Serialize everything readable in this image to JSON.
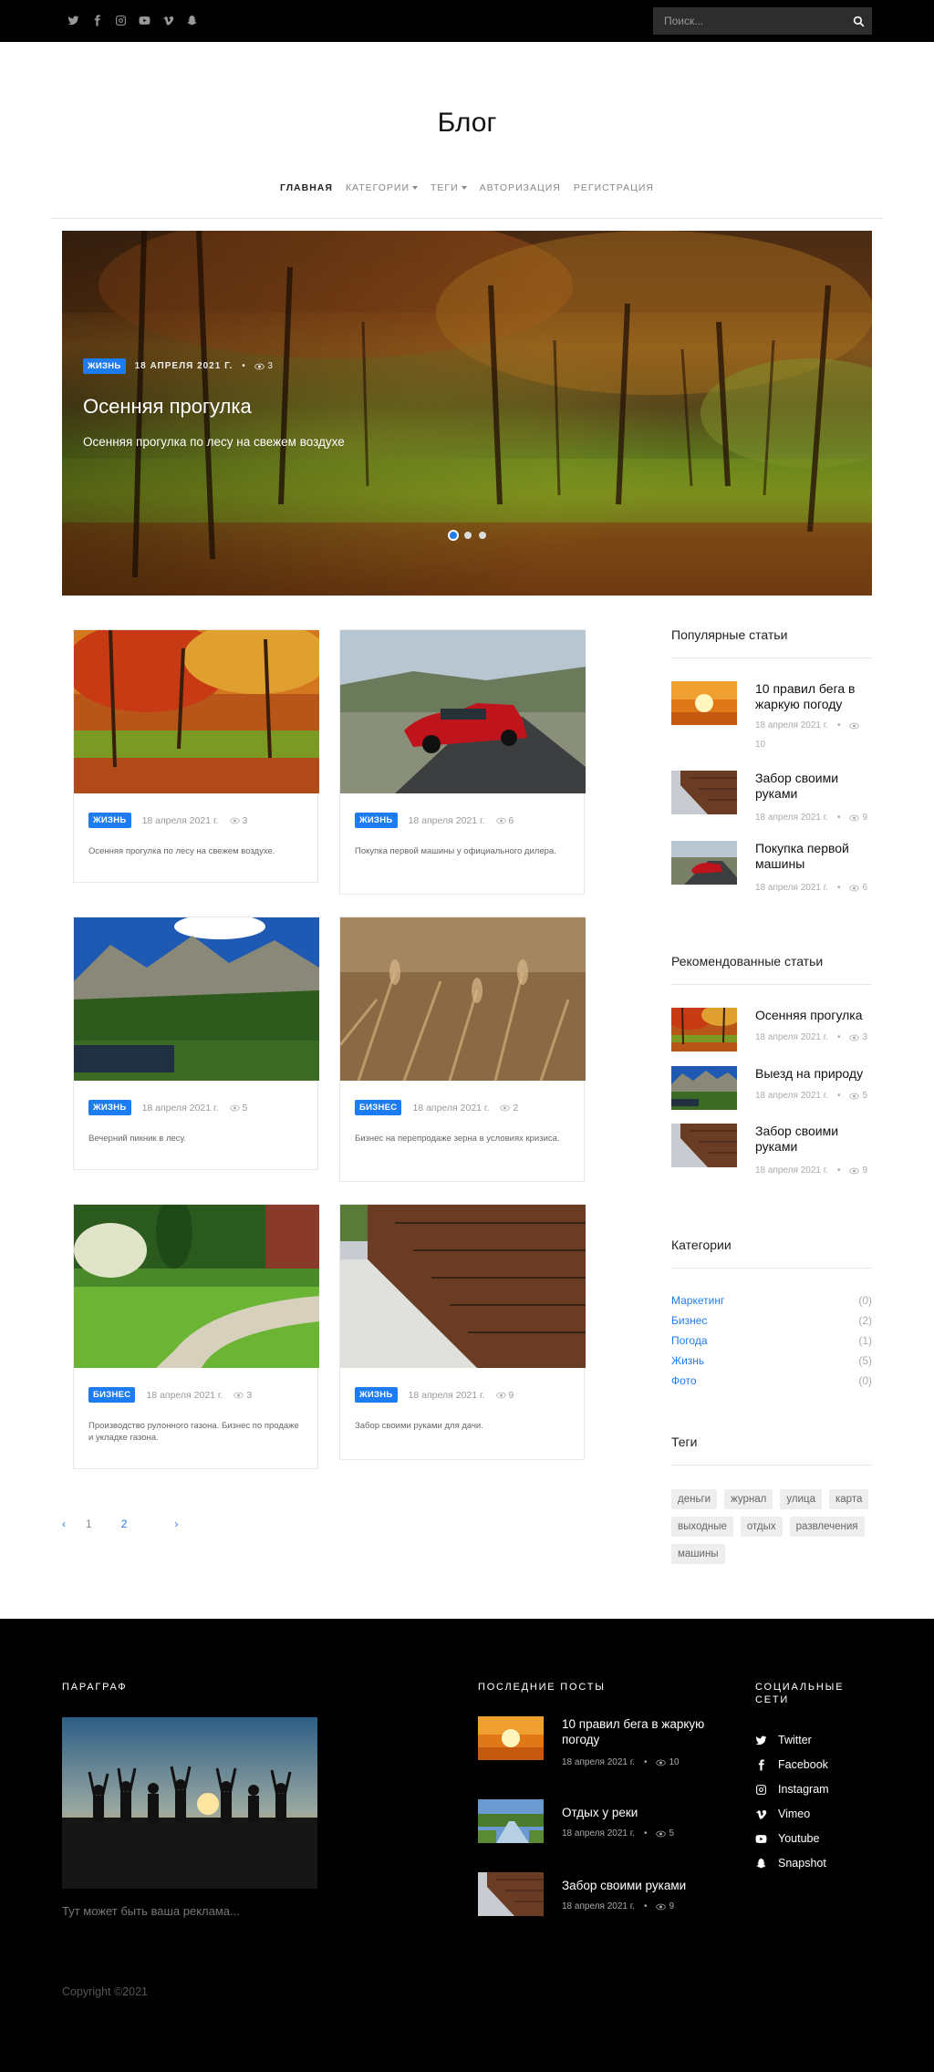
{
  "search": {
    "placeholder": "Поиск..."
  },
  "site": {
    "title": "Блог"
  },
  "nav": [
    {
      "label": "Главная",
      "active": true,
      "dropdown": false
    },
    {
      "label": "Категории",
      "active": false,
      "dropdown": true
    },
    {
      "label": "Теги",
      "active": false,
      "dropdown": true
    },
    {
      "label": "Авторизация",
      "active": false,
      "dropdown": false
    },
    {
      "label": "Регистрация",
      "active": false,
      "dropdown": false
    }
  ],
  "hero": {
    "category": "Жизнь",
    "date": "18 апреля 2021 г.",
    "views": "3",
    "title": "Осенняя прогулка",
    "subtitle": "Осенняя прогулка по лесу на свежем воздухе",
    "slides": 3,
    "active_slide": 1
  },
  "posts": [
    {
      "category": "Жизнь",
      "date": "18 апреля 2021 г.",
      "views": "3",
      "description": "Осенняя прогулка по лесу на свежем воздухе.",
      "image": "autumn-forest"
    },
    {
      "category": "Жизнь",
      "date": "18 апреля 2021 г.",
      "views": "6",
      "description": "Покупка первой машины у официального дилера.",
      "image": "red-car"
    },
    {
      "category": "Жизнь",
      "date": "18 апреля 2021 г.",
      "views": "5",
      "description": "Вечерний пикник в лесу.",
      "image": "mountain-lake"
    },
    {
      "category": "Бизнес",
      "date": "18 апреля 2021 г.",
      "views": "2",
      "description": "Бизнес на перепродаже зерна в условиях кризиса.",
      "image": "wheat"
    },
    {
      "category": "Бизнес",
      "date": "18 апреля 2021 г.",
      "views": "3",
      "description": "Производство рулонного газона. Бизнес по продаже и укладке газона.",
      "image": "lawn"
    },
    {
      "category": "Жизнь",
      "date": "18 апреля 2021 г.",
      "views": "9",
      "description": "Забор своими руками для дачи.",
      "image": "fence"
    }
  ],
  "pagination": {
    "prev": "‹",
    "pages": [
      "1",
      "2"
    ],
    "current": "1",
    "next": "›"
  },
  "sidebar": {
    "popular_title": "Популярные статьи",
    "popular": [
      {
        "title": "10 правил бега в жаркую погоду",
        "date": "18 апреля 2021 г.",
        "views": "10",
        "image": "sun"
      },
      {
        "title": "Забор своими руками",
        "date": "18 апреля 2021 г.",
        "views": "9",
        "image": "fence"
      },
      {
        "title": "Покупка первой машины",
        "date": "18 апреля 2021 г.",
        "views": "6",
        "image": "red-car"
      }
    ],
    "recommended_title": "Рекомендованные статьи",
    "recommended": [
      {
        "title": "Осенняя прогулка",
        "date": "18 апреля 2021 г.",
        "views": "3",
        "image": "autumn-forest"
      },
      {
        "title": "Выезд на природу",
        "date": "18 апреля 2021 г.",
        "views": "5",
        "image": "mountain-lake"
      },
      {
        "title": "Забор своими руками",
        "date": "18 апреля 2021 г.",
        "views": "9",
        "image": "fence"
      }
    ],
    "categories_title": "Категории",
    "categories": [
      {
        "name": "Маркетинг",
        "count": "(0)"
      },
      {
        "name": "Бизнес",
        "count": "(2)"
      },
      {
        "name": "Погода",
        "count": "(1)"
      },
      {
        "name": "Жизнь",
        "count": "(5)"
      },
      {
        "name": "Фото",
        "count": "(0)"
      }
    ],
    "tags_title": "Теги",
    "tags": [
      "деньги",
      "журнал",
      "улица",
      "карта",
      "выходные",
      "отдых",
      "развлечения",
      "машины"
    ]
  },
  "footer": {
    "about_title": "Параграф",
    "ad_text": "Тут может быть ваша реклама...",
    "recent_title": "Последние посты",
    "recent": [
      {
        "title": "10 правил бега в жаркую погоду",
        "date": "18 апреля 2021 г.",
        "views": "10",
        "image": "sun"
      },
      {
        "title": "Отдых у реки",
        "date": "18 апреля 2021 г.",
        "views": "5",
        "image": "river"
      },
      {
        "title": "Забор своими руками",
        "date": "18 апреля 2021 г.",
        "views": "9",
        "image": "fence"
      }
    ],
    "social_title": "Социальные сети",
    "social": [
      {
        "label": "Twitter",
        "icon": "twitter-icon"
      },
      {
        "label": "Facebook",
        "icon": "facebook-icon"
      },
      {
        "label": "Instagram",
        "icon": "instagram-icon"
      },
      {
        "label": "Vimeo",
        "icon": "vimeo-icon"
      },
      {
        "label": "Youtube",
        "icon": "youtube-icon"
      },
      {
        "label": "Snapshot",
        "icon": "snapchat-icon"
      }
    ],
    "copyright": "Copyright ©2021"
  },
  "colors": {
    "accent": "#1e7cf2",
    "topbar": "#000000",
    "footer": "#000000"
  }
}
